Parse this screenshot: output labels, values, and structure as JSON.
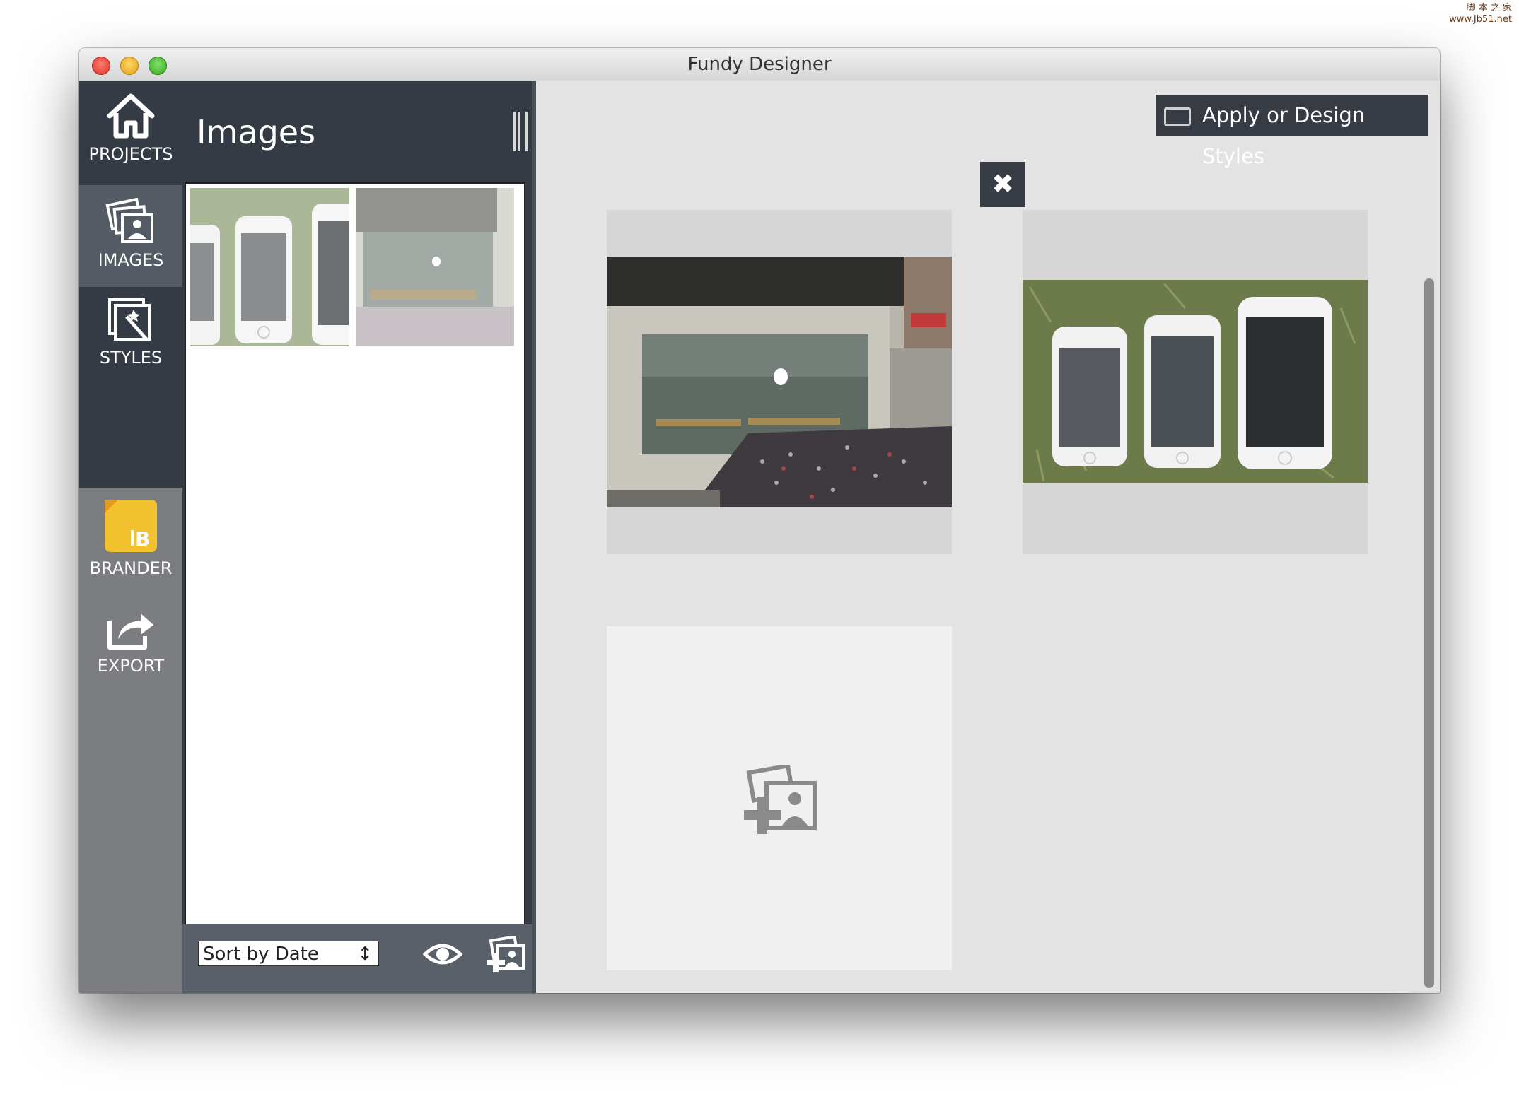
{
  "watermark": {
    "line1": "脚 本 之 家",
    "line2": "www.Jb51.net"
  },
  "window": {
    "title": "Fundy Designer"
  },
  "nav": {
    "projects": "PROJECTS",
    "images": "IMAGES",
    "styles": "STYLES",
    "brander": "BRANDER",
    "export": "EXPORT"
  },
  "images_panel": {
    "title": "Images",
    "sort": {
      "selected": "Sort by Date"
    }
  },
  "main": {
    "apply_styles_label": "Apply or Design Styles",
    "close_glyph": "✖"
  },
  "colors": {
    "dark_nav": "#353b45",
    "grey_nav": "#7b7d80",
    "workspace": "#e3e3e3",
    "brander_yellow": "#f2c12e"
  },
  "icons": [
    "home-icon",
    "images-icon",
    "styles-icon",
    "brander-icon",
    "export-icon",
    "eye-icon",
    "add-images-icon",
    "close-icon"
  ]
}
